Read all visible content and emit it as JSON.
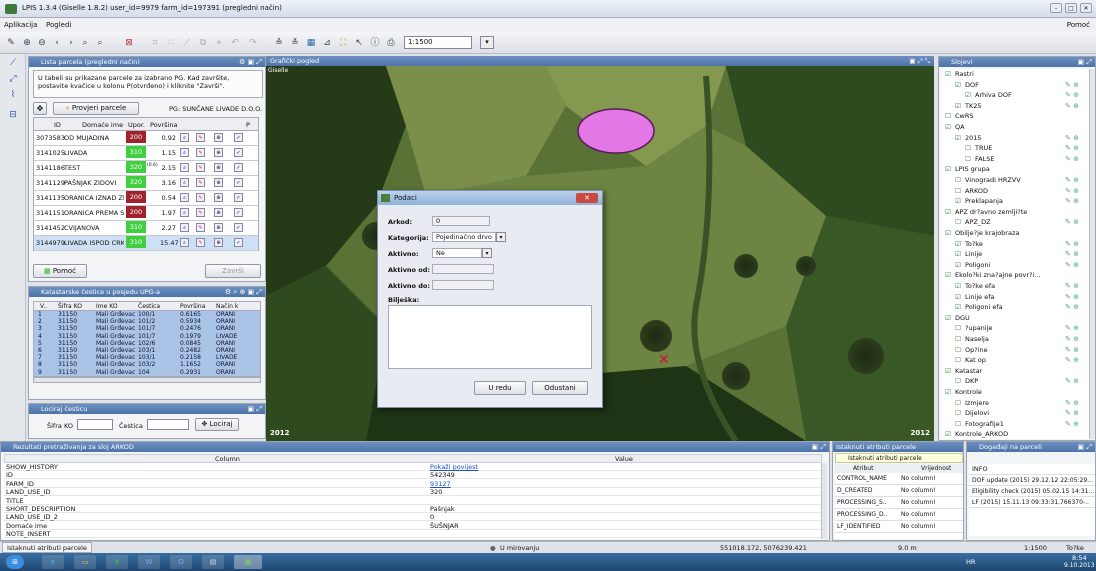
{
  "window": {
    "title": "LPIS 1.3.4 (Giselle 1.8.2) user_id=9979 farm_id=197391 (pregledni način)"
  },
  "menu": {
    "app": "Aplikacija",
    "view": "Pogledi",
    "help": "Pomoć"
  },
  "toolbar": {
    "scale": "1:1500"
  },
  "parcels": {
    "title": "Lista parcela (pregledni način)",
    "note": "U tabeli su prikazane parcele za izabrano PG. Kad završite, postavite kvačice u kolonu P(otvrđeno) i kliknite \"Završi\".",
    "check_button": "Provjeri parcele",
    "pg": "PG: SUNČANE LIVADE D.O.O.",
    "columns": [
      "ID",
      "Domaće ime",
      "Upor.",
      "Površina",
      "P"
    ],
    "rows": [
      {
        "id": "3073583",
        "name": "OD MUJADINA",
        "upor": "200",
        "area": "0.92",
        "pre": ""
      },
      {
        "id": "3141025",
        "name": "LIVADA",
        "upor": "310",
        "area": "1.15",
        "pre": ""
      },
      {
        "id": "3141186",
        "name": "TEST",
        "upor": "320",
        "area": "2.15",
        "pre": "(0.6)"
      },
      {
        "id": "3141129",
        "name": "PAŠNJAK ZIDOVI",
        "upor": "320",
        "area": "3.16",
        "pre": ""
      },
      {
        "id": "3141135",
        "name": "ORANICA IZNAD ZI..",
        "upor": "200",
        "area": "0.54",
        "pre": ""
      },
      {
        "id": "3141151",
        "name": "ORANICA PREMA S..",
        "upor": "200",
        "area": "1.97",
        "pre": ""
      },
      {
        "id": "3141452",
        "name": "CVIJANOVA",
        "upor": "310",
        "area": "2.27",
        "pre": ""
      },
      {
        "id": "3144979",
        "name": "LIVADA ISPOD CRK..",
        "upor": "310",
        "area": "15.47",
        "pre": ""
      }
    ],
    "help_button": "Pomoć",
    "finish_button": "Završi"
  },
  "cadastre": {
    "title": "Katastarske čestice u posjedu UPG-a",
    "columns": [
      "V..",
      "Šifra KO",
      "Ime KO",
      "Čestica",
      "Površina",
      "Način k"
    ],
    "rows": [
      [
        "1",
        "31150",
        "Mali Grđevac",
        "100/1",
        "0.6165",
        "ORANI"
      ],
      [
        "2",
        "31150",
        "Mali Grđevac",
        "101/2",
        "0.5934",
        "ORANI"
      ],
      [
        "3",
        "31150",
        "Mali Grđevac",
        "101/7",
        "0.2476",
        "ORANI"
      ],
      [
        "4",
        "31150",
        "Mali Grđevac",
        "101/7",
        "0.1979",
        "LIVADE"
      ],
      [
        "5",
        "31150",
        "Mali Grđevac",
        "102/6",
        "0.0845",
        "ORANI"
      ],
      [
        "6",
        "31150",
        "Mali Grđevac",
        "103/1",
        "0.2482",
        "ORANI"
      ],
      [
        "7",
        "31150",
        "Mali Grđevac",
        "103/1",
        "0.2158",
        "LIVADE"
      ],
      [
        "8",
        "31150",
        "Mali Grđevac",
        "103/2",
        "1.1652",
        "ORANI"
      ],
      [
        "9",
        "31150",
        "Mali Grđevac",
        "104",
        "0.2931",
        "ORANI"
      ]
    ]
  },
  "locate": {
    "title": "Lociraj česticu",
    "ko_label": "Šifra KO",
    "parcel_label": "Čestica",
    "button": "Lociraj"
  },
  "map": {
    "title": "Grafički pogled",
    "sub": "Giselle",
    "year_left": "2012",
    "year_right": "2012"
  },
  "dialog": {
    "title": "Podaci",
    "arkod_label": "Arkod:",
    "arkod_value": "0",
    "category_label": "Kategorija:",
    "category_value": "Pojedinačno drvo",
    "active_label": "Aktivno:",
    "active_value": "Ne",
    "from_label": "Aktivno od:",
    "to_label": "Aktivno do:",
    "note_label": "Bilješka:",
    "ok": "U redu",
    "cancel": "Odustani"
  },
  "layers": {
    "title": "Slojevi",
    "items": [
      "Rastri",
      "DOF",
      "Arhiva DOF",
      "TK25",
      "CwRS",
      "QA",
      "2015",
      "TRUE",
      "FALSE",
      "LPIS grupa",
      "Vinogradi HRZVV",
      "ARKOD",
      "Preklapanja",
      "APZ dr?avno zemlji?te",
      "APZ_DZ",
      "Obilje?je krajobraza",
      "To?ke",
      "Linije",
      "Poligoni",
      "Ekolo?ki zna?ajne povr?i...",
      "To?ke efa",
      "Linije efa",
      "Poligoni efa",
      "DGU",
      "?upanije",
      "Naselja",
      "Op?ine",
      "Kat op",
      "Katastar",
      "DKP",
      "Kontrole",
      "Izmjere",
      "Dijelovi",
      "Fotografije1",
      "Kontrole_ARKOD"
    ]
  },
  "results": {
    "title": "Rezultati pretraživanja za sloj ARKOD",
    "col_column": "Column",
    "col_value": "Value",
    "rows": [
      [
        "SHOW_HISTORY",
        "Pokaži povijest"
      ],
      [
        "ID",
        "542349"
      ],
      [
        "FARM_ID",
        "93127"
      ],
      [
        "LAND_USE_ID",
        "320"
      ],
      [
        "TITLE",
        ""
      ],
      [
        "SHORT_DESCRIPTION",
        "Pašnjak"
      ],
      [
        "LAND_USE_ID_2",
        "0"
      ],
      [
        "Domaće ime",
        "ŠUŠNJAR"
      ],
      [
        "NOTE_INSERT",
        ""
      ]
    ]
  },
  "instant": {
    "title": "Istaknuti atributi parcele",
    "sub": "Istaknuti atributi parcele",
    "col1": "Atribut",
    "col2": "Vrijednost",
    "rows": [
      [
        "CONTROL_NAME",
        "No column!"
      ],
      [
        "D_CREATED",
        "No column!"
      ],
      [
        "PROCESSING_S..",
        "No column!"
      ],
      [
        "PROCESSING_D..",
        "No column!"
      ],
      [
        "LF_IDENTIFIED",
        "No column!"
      ]
    ]
  },
  "events": {
    "title": "Događaji na parceli",
    "header": "INFO",
    "rows": [
      "DOF update (2015) 29.12.12 22:05:29...",
      "Eligibility check (2015) 05.02.15 14:31...",
      "LF (2015) 15.11.13 09:33:31,766370-.."
    ]
  },
  "status": {
    "tab": "Istaknuti atributi parcele",
    "state": "U mirovanju",
    "coords": "551018.172, 5076239.421",
    "dist": "9.0 m",
    "scale": "1:1500",
    "point": "To?ke"
  },
  "taskbar": {
    "lang": "HR",
    "time": "8:54",
    "date": "9.10.2013"
  }
}
